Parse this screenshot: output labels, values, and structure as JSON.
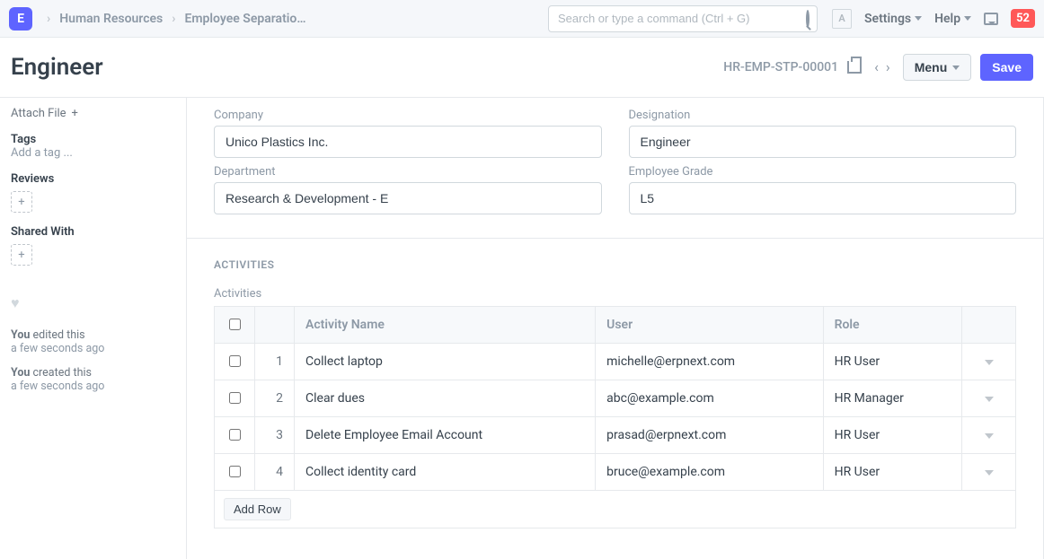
{
  "navbar": {
    "logo_letter": "E",
    "breadcrumb1": "Human Resources",
    "breadcrumb2": "Employee Separatio…",
    "search_placeholder": "Search or type a command (Ctrl + G)",
    "avatar_letter": "A",
    "settings": "Settings",
    "help": "Help",
    "notifications": "52"
  },
  "page": {
    "title": "Engineer",
    "doc_id": "HR-EMP-STP-00001",
    "menu_btn": "Menu",
    "save_btn": "Save"
  },
  "sidebar": {
    "attach": "Attach File",
    "tags_label": "Tags",
    "add_tag": "Add a tag ...",
    "reviews_label": "Reviews",
    "shared_label": "Shared With",
    "timeline": {
      "e1a": "You",
      "e1b": "edited this",
      "e1when": "a few seconds ago",
      "e2a": "You",
      "e2b": "created this",
      "e2when": "a few seconds ago"
    }
  },
  "form": {
    "company_label": "Company",
    "company": "Unico Plastics Inc.",
    "designation_label": "Designation",
    "designation": "Engineer",
    "department_label": "Department",
    "department": "Research & Development - E",
    "grade_label": "Employee Grade",
    "grade": "L5"
  },
  "activities": {
    "section_title": "ACTIVITIES",
    "sub_label": "Activities",
    "add_row": "Add Row",
    "cols": {
      "activity": "Activity Name",
      "user": "User",
      "role": "Role"
    },
    "rows": [
      {
        "idx": "1",
        "activity": "Collect laptop",
        "user": "michelle@erpnext.com",
        "role": "HR User"
      },
      {
        "idx": "2",
        "activity": "Clear dues",
        "user": "abc@example.com",
        "role": "HR Manager"
      },
      {
        "idx": "3",
        "activity": "Delete Employee Email Account",
        "user": "prasad@erpnext.com",
        "role": "HR User"
      },
      {
        "idx": "4",
        "activity": "Collect identity card",
        "user": "bruce@example.com",
        "role": "HR User"
      }
    ]
  }
}
